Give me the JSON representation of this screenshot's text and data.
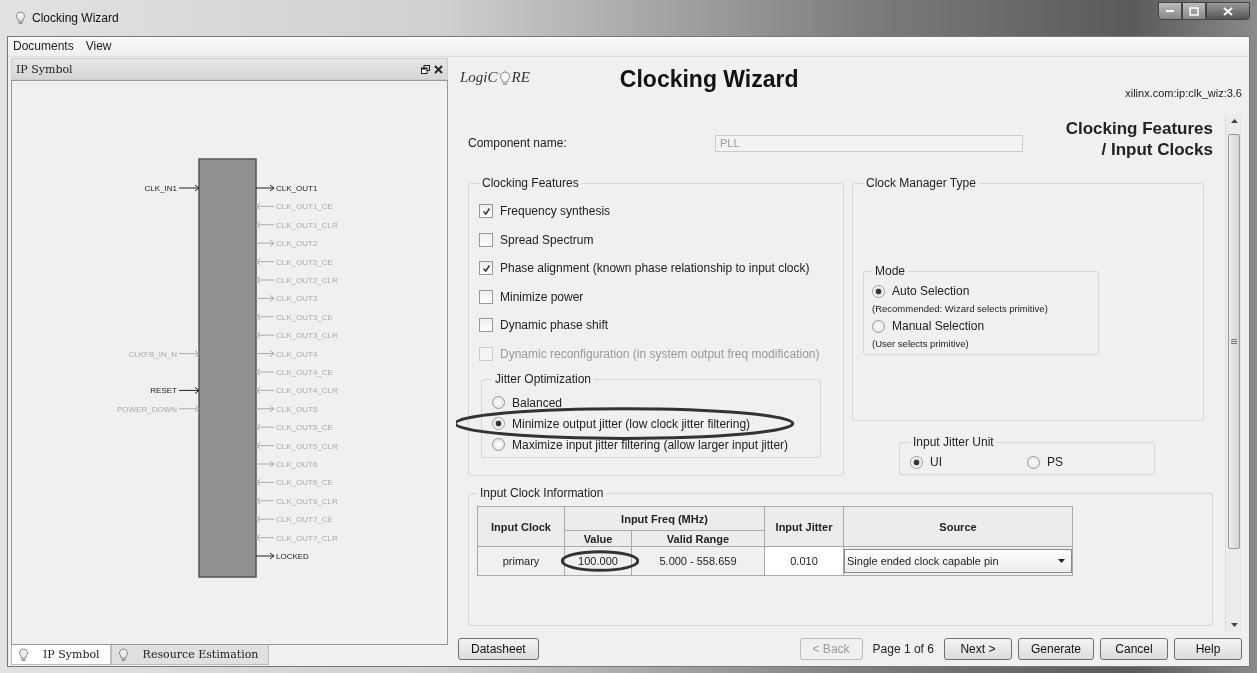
{
  "window": {
    "title": "Clocking Wizard"
  },
  "menu": [
    "Documents",
    "View"
  ],
  "left_panel": {
    "title": "IP Symbol",
    "symbol": {
      "rows": [
        {
          "left": {
            "name": "CLK_IN1",
            "enabled": true
          },
          "right": {
            "name": "CLK_OUT1",
            "kind": "output",
            "enabled": true
          }
        },
        {
          "right": {
            "name": "CLK_OUT1_CE",
            "kind": "input",
            "enabled": false
          }
        },
        {
          "right": {
            "name": "CLK_OUT1_CLR",
            "kind": "input",
            "enabled": false
          }
        },
        {
          "right": {
            "name": "CLK_OUT2",
            "kind": "output",
            "enabled": false
          }
        },
        {
          "right": {
            "name": "CLK_OUT2_CE",
            "kind": "input",
            "enabled": false
          }
        },
        {
          "right": {
            "name": "CLK_OUT2_CLR",
            "kind": "input",
            "enabled": false
          }
        },
        {
          "right": {
            "name": "CLK_OUT3",
            "kind": "output",
            "enabled": false
          }
        },
        {
          "right": {
            "name": "CLK_OUT3_CE",
            "kind": "input",
            "enabled": false
          }
        },
        {
          "right": {
            "name": "CLK_OUT3_CLR",
            "kind": "input",
            "enabled": false
          }
        },
        {
          "left": {
            "name": "CLKFB_IN_N",
            "enabled": false
          },
          "right": {
            "name": "CLK_OUT4",
            "kind": "output",
            "enabled": false
          }
        },
        {
          "right": {
            "name": "CLK_OUT4_CE",
            "kind": "input",
            "enabled": false
          }
        },
        {
          "left": {
            "name": "RESET",
            "enabled": true
          },
          "right": {
            "name": "CLK_OUT4_CLR",
            "kind": "input",
            "enabled": false
          }
        },
        {
          "left": {
            "name": "POWER_DOWN",
            "enabled": false
          },
          "right": {
            "name": "CLK_OUT5",
            "kind": "output",
            "enabled": false
          }
        },
        {
          "right": {
            "name": "CLK_OUT5_CE",
            "kind": "input",
            "enabled": false
          }
        },
        {
          "right": {
            "name": "CLK_OUT5_CLR",
            "kind": "input",
            "enabled": false
          }
        },
        {
          "right": {
            "name": "CLK_OUT6",
            "kind": "output",
            "enabled": false
          }
        },
        {
          "right": {
            "name": "CLK_OUT6_CE",
            "kind": "input",
            "enabled": false
          }
        },
        {
          "right": {
            "name": "CLK_OUT6_CLR",
            "kind": "input",
            "enabled": false
          }
        },
        {
          "right": {
            "name": "CLK_OUT7_CE",
            "kind": "input",
            "enabled": false
          }
        },
        {
          "right": {
            "name": "CLK_OUT7_CLR",
            "kind": "input",
            "enabled": false
          }
        },
        {
          "right": {
            "name": "LOCKED",
            "kind": "output",
            "enabled": true
          }
        }
      ]
    },
    "tabs": [
      {
        "label": "IP Symbol",
        "selected": true
      },
      {
        "label": "Resource Estimation",
        "selected": false
      }
    ]
  },
  "wizard": {
    "logo": {
      "left": "LogiC",
      "right": "RE"
    },
    "title": "Clocking Wizard",
    "ip_id": "xilinx.com:ip:clk_wiz:3.6",
    "page_title": [
      "Clocking Features",
      "/ Input Clocks"
    ],
    "component_name": {
      "label": "Component name:",
      "value": "PLL",
      "disabled": true
    },
    "clocking_features": {
      "title": "Clocking Features",
      "options": [
        {
          "label": "Frequency synthesis",
          "checked": true,
          "disabled": false
        },
        {
          "label": "Spread Spectrum",
          "checked": false,
          "disabled": false
        },
        {
          "label": "Phase alignment (known phase relationship to input clock)",
          "checked": true,
          "disabled": false
        },
        {
          "label": "Minimize power",
          "checked": false,
          "disabled": false
        },
        {
          "label": "Dynamic phase shift",
          "checked": false,
          "disabled": false
        },
        {
          "label": "Dynamic reconfiguration (in system output freq modification)",
          "checked": false,
          "disabled": true
        }
      ]
    },
    "jitter_optimization": {
      "title": "Jitter Optimization",
      "options": [
        {
          "label": "Balanced",
          "selected": false,
          "circled": false
        },
        {
          "label": "Minimize output jitter (low clock jitter filtering)",
          "selected": true,
          "circled": true
        },
        {
          "label": "Maximize input jitter filtering (allow larger input jitter)",
          "selected": false,
          "circled": false
        }
      ]
    },
    "clock_manager_type": {
      "title": "Clock Manager Type",
      "mode": {
        "title": "Mode",
        "options": [
          {
            "label": "Auto Selection",
            "note": "(Recommended:  Wizard selects primitive)",
            "selected": true
          },
          {
            "label": "Manual Selection",
            "note": "(User selects primitive)",
            "selected": false
          }
        ]
      }
    },
    "input_jitter_unit": {
      "title": "Input Jitter Unit",
      "options": [
        {
          "label": "UI",
          "selected": true
        },
        {
          "label": "PS",
          "selected": false
        }
      ]
    },
    "input_clock_information": {
      "title": "Input Clock Information",
      "table": {
        "headers": {
          "input_clock": "Input Clock",
          "input_freq": "Input Freq (MHz)",
          "value": "Value",
          "valid_range": "Valid Range",
          "input_jitter": "Input Jitter",
          "source": "Source"
        },
        "rows": [
          {
            "input_clock": "primary",
            "value": "100.000",
            "value_circled": true,
            "valid_range": "5.000 - 558.659",
            "input_jitter": "0.010",
            "source": "Single ended clock capable pin"
          }
        ]
      }
    },
    "footer": {
      "datasheet": {
        "label": "Datasheet",
        "disabled": false
      },
      "back": {
        "label": "< Back",
        "disabled": true
      },
      "page_indicator": "Page 1 of 6",
      "actions": [
        {
          "label": "Next >",
          "disabled": false
        },
        {
          "label": "Generate",
          "disabled": false
        },
        {
          "label": "Cancel",
          "disabled": false
        },
        {
          "label": "Help",
          "disabled": false
        }
      ]
    }
  }
}
